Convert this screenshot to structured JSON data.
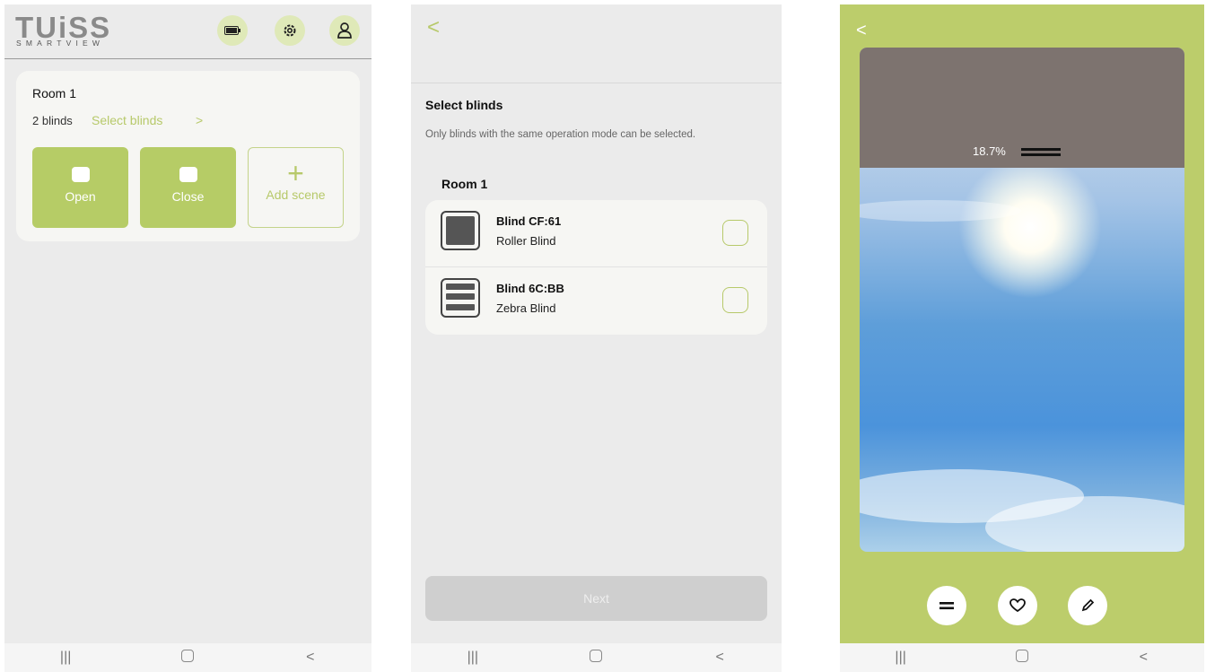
{
  "screen1": {
    "logo": {
      "main": "TUiSS",
      "sub": "SMARTVIEW"
    },
    "header_icons": [
      "battery-icon",
      "gear-icon",
      "user-icon"
    ],
    "room": {
      "title": "Room 1",
      "count": "2 blinds",
      "select_link": "Select blinds",
      "chevron": ">",
      "scenes": [
        {
          "label": "Open",
          "icon": "open-scene-icon"
        },
        {
          "label": "Close",
          "icon": "close-scene-icon"
        }
      ],
      "add_label": "Add scene",
      "add_symbol": "+"
    },
    "nav": {
      "recent": "|||",
      "back": "<"
    }
  },
  "screen2": {
    "back": "<",
    "title": "Select blinds",
    "description": "Only blinds with the same operation mode can be selected.",
    "room": "Room 1",
    "blinds": [
      {
        "name": "Blind CF:61",
        "type": "Roller Blind",
        "checked": false
      },
      {
        "name": "Blind 6C:BB",
        "type": "Zebra Blind",
        "checked": false
      }
    ],
    "next_label": "Next",
    "nav": {
      "recent": "|||",
      "back": "<"
    }
  },
  "screen3": {
    "back": "<",
    "position_text": "18.7%",
    "position_value": 18.7,
    "controls": [
      "equals-icon",
      "heart-icon",
      "pencil-icon"
    ],
    "accent": "#bccd6b",
    "nav": {
      "recent": "|||",
      "back": "<"
    }
  }
}
